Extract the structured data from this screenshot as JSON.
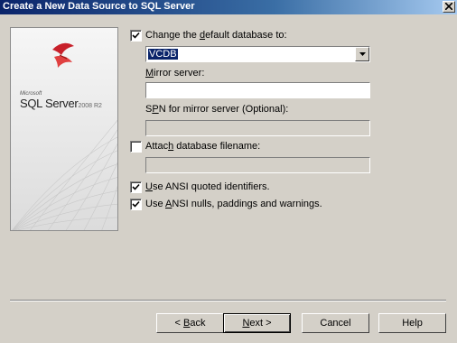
{
  "window": {
    "title": "Create a New Data Source to SQL Server"
  },
  "branding": {
    "maker": "Microsoft",
    "product": "SQL Server",
    "version": "2008 R2"
  },
  "options": {
    "change_default_db": {
      "label_pre": "Change the ",
      "label_key": "d",
      "label_post": "efault database to:",
      "checked": true
    },
    "default_db_value": "VCDB",
    "mirror_server": {
      "label_key": "M",
      "label_post": "irror server:",
      "value": ""
    },
    "spn_mirror": {
      "label_pre": "S",
      "label_key": "P",
      "label_post": "N for mirror server (Optional):",
      "value": ""
    },
    "attach_db": {
      "label_pre": "Attac",
      "label_key": "h",
      "label_post": " database filename:",
      "checked": false,
      "value": ""
    },
    "ansi_quoted": {
      "label_pre": "",
      "label_key": "U",
      "label_post": "se ANSI quoted identifiers.",
      "checked": true
    },
    "ansi_nulls": {
      "label_pre": "Use ",
      "label_key": "A",
      "label_post": "NSI nulls, paddings and warnings.",
      "checked": true
    }
  },
  "buttons": {
    "back": {
      "arrow": "< ",
      "key": "B",
      "rest": "ack"
    },
    "next": {
      "key": "N",
      "rest": "ext >"
    },
    "cancel": "Cancel",
    "help": "Help"
  }
}
